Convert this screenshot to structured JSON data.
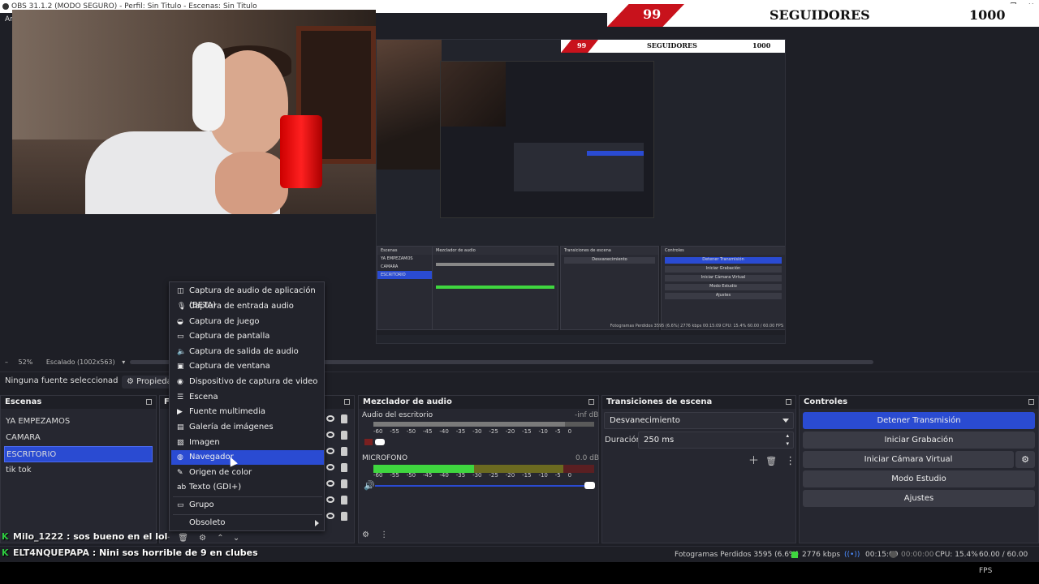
{
  "window": {
    "title": "OBS 31.1.2 (MODO SEGURO) - Perfil: Sin Titulo - Escenas: Sin Titulo",
    "controls": [
      "—",
      "❐",
      "✕"
    ],
    "menu_partial": "Ar"
  },
  "banner": {
    "followers_current": "99",
    "label": "SEGUIDORES",
    "followers_goal": "1000"
  },
  "preview": {
    "banner_current": "99",
    "banner_label": "SEGUIDORES",
    "banner_goal": "1000",
    "status_text": "Fotogramas Perdidos 3595 (6.6%)   2776 kbps   00:15:09   CPU: 15.4%   60.00 / 60.00 FPS",
    "inner_labels": [
      "Escenas",
      "Mezclador de audio",
      "Transiciones de escena",
      "Controles"
    ],
    "inner_buttons": [
      "Detener Transmisión",
      "Iniciar Grabación",
      "Iniciar Cámara Virtual",
      "Modo Estudio",
      "Ajustes"
    ],
    "inner_scenes": [
      "YA EMPEZAMOS",
      "CAMARA",
      "ESCRITORIO"
    ]
  },
  "scale_bar": {
    "zoom": "52%",
    "scaled": "Escalado (1002x563)"
  },
  "props_bar": {
    "no_source": "Ninguna fuente seleccionad",
    "properties": "Propiedade"
  },
  "scenes": {
    "header": "Escenas",
    "items": [
      "YA EMPEZAMOS",
      "CAMARA",
      "ESCRITORIO",
      "tik tok"
    ],
    "selected_index": 2
  },
  "sources": {
    "header_partial": "Fu"
  },
  "mixer": {
    "header": "Mezclador de audio",
    "channels": [
      {
        "name": "Audio del escritorio",
        "level": "-inf dB"
      },
      {
        "name": "MICROFONO",
        "level": "0.0 dB"
      }
    ],
    "ticks": [
      "-60",
      "-55",
      "-50",
      "-45",
      "-40",
      "-35",
      "-30",
      "-25",
      "-20",
      "-15",
      "-10",
      "-5",
      "0"
    ]
  },
  "transitions": {
    "header": "Transiciones de escena",
    "selected": "Desvanecimiento",
    "duration_label": "Duración",
    "duration_value": "250 ms"
  },
  "controls": {
    "header": "Controles",
    "buttons": [
      "Detener Transmisión",
      "Iniciar Grabación",
      "Iniciar Cámara Virtual",
      "Modo Estudio",
      "Ajustes"
    ]
  },
  "context_menu": {
    "items": [
      {
        "label": "Captura de audio de aplicación (BETA)",
        "icon": "app-audio-icon"
      },
      {
        "label": "Captura de entrada audio",
        "icon": "microphone-icon"
      },
      {
        "label": "Captura de juego",
        "icon": "gamepad-icon"
      },
      {
        "label": "Captura de pantalla",
        "icon": "monitor-icon"
      },
      {
        "label": "Captura de salida de audio",
        "icon": "speaker-icon"
      },
      {
        "label": "Captura de ventana",
        "icon": "window-icon"
      },
      {
        "label": "Dispositivo de captura de video",
        "icon": "camera-icon"
      },
      {
        "label": "Escena",
        "icon": "scene-list-icon"
      },
      {
        "label": "Fuente multimedia",
        "icon": "media-play-icon"
      },
      {
        "label": "Galería de imágenes",
        "icon": "image-gallery-icon"
      },
      {
        "label": "Imagen",
        "icon": "image-icon"
      },
      {
        "label": "Navegador",
        "icon": "globe-icon"
      },
      {
        "label": "Origen de color",
        "icon": "brush-icon"
      },
      {
        "label": "Texto (GDI+)",
        "icon": "text-icon"
      },
      {
        "label": "Grupo",
        "icon": "folder-icon"
      },
      {
        "label": "Obsoleto",
        "icon": ""
      }
    ],
    "highlighted_index": 11
  },
  "chat": [
    {
      "user": "Milo_1222",
      "message": "sos bueno en el lol"
    },
    {
      "user": "ELT4NQUEPAPA",
      "message": "Nini sos horrible de 9 en clubes"
    }
  ],
  "statusbar": {
    "dropped": "Fotogramas Perdidos 3595 (6.6%)",
    "bitrate": "2776 kbps",
    "stream_time": "00:15:09",
    "rec_time": "00:00:00",
    "cpu": "CPU: 15.4%",
    "fps": "60.00 / 60.00 FPS"
  },
  "colors": {
    "accent": "#2a4bd2",
    "banner_red": "#c8121c",
    "meter_green": "#3fd63f",
    "meter_yellow": "#b8b32a",
    "meter_red": "#c8242a"
  }
}
